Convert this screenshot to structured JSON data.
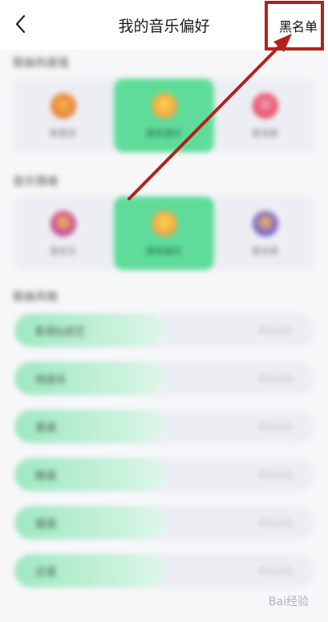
{
  "header": {
    "back_icon": "chevron-left-icon",
    "title": "我的音乐偏好",
    "blacklist_label": "黑名单"
  },
  "colors": {
    "accent": "#5fdc9a",
    "annotation": "#b4211c"
  },
  "sections": [
    {
      "title": "歌曲热度值",
      "tiles": [
        {
          "label": "新歌控",
          "active": false
        },
        {
          "label": "都有喜欢",
          "active": true
        },
        {
          "label": "爱老歌",
          "active": false
        }
      ]
    },
    {
      "title": "音乐情绪",
      "tiles": [
        {
          "label": "爱欢乐",
          "active": false
        },
        {
          "label": "都有喜欢",
          "active": true
        },
        {
          "label": "爱伤感",
          "active": false
        }
      ]
    }
  ],
  "style_section": {
    "title": "歌曲风格",
    "items": [
      {
        "label": "影视&综艺",
        "value": "听过占比"
      },
      {
        "label": "纯音乐",
        "value": "听过占比"
      },
      {
        "label": "英语",
        "value": "听过占比"
      },
      {
        "label": "韩语",
        "value": "听过占比"
      },
      {
        "label": "国语",
        "value": "听过占比"
      },
      {
        "label": "日语",
        "value": "听过占比"
      }
    ]
  },
  "watermark": "Bai经验"
}
